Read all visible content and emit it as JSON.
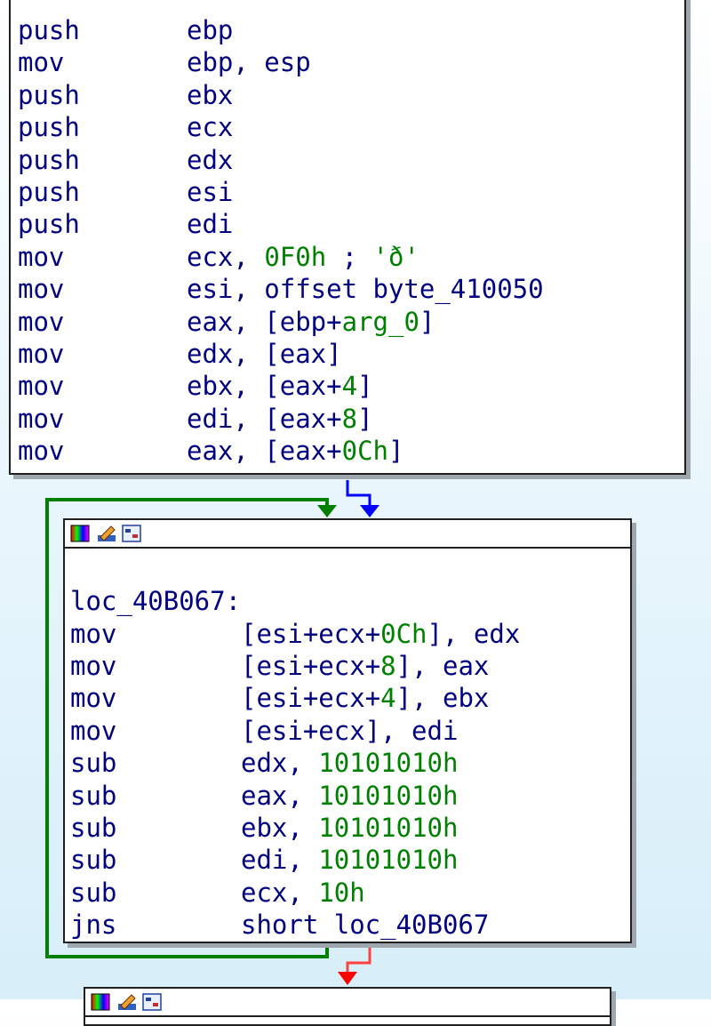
{
  "block1": {
    "lines": [
      {
        "mn": "push",
        "ops": [
          {
            "t": "ebp",
            "c": "reg"
          }
        ]
      },
      {
        "mn": "mov",
        "ops": [
          {
            "t": "ebp, esp",
            "c": "reg"
          }
        ]
      },
      {
        "mn": "push",
        "ops": [
          {
            "t": "ebx",
            "c": "reg"
          }
        ]
      },
      {
        "mn": "push",
        "ops": [
          {
            "t": "ecx",
            "c": "reg"
          }
        ]
      },
      {
        "mn": "push",
        "ops": [
          {
            "t": "edx",
            "c": "reg"
          }
        ]
      },
      {
        "mn": "push",
        "ops": [
          {
            "t": "esi",
            "c": "reg"
          }
        ]
      },
      {
        "mn": "push",
        "ops": [
          {
            "t": "edi",
            "c": "reg"
          }
        ]
      },
      {
        "mn": "mov",
        "ops": [
          {
            "t": "ecx, ",
            "c": "reg"
          },
          {
            "t": "0F0h",
            "c": "num"
          },
          {
            "t": " ; ",
            "c": "cmt"
          },
          {
            "t": "'ð'",
            "c": "str"
          }
        ]
      },
      {
        "mn": "mov",
        "ops": [
          {
            "t": "esi, offset byte_410050",
            "c": "reg"
          }
        ]
      },
      {
        "mn": "mov",
        "ops": [
          {
            "t": "eax, [ebp+",
            "c": "reg"
          },
          {
            "t": "arg_0",
            "c": "arg"
          },
          {
            "t": "]",
            "c": "reg"
          }
        ]
      },
      {
        "mn": "mov",
        "ops": [
          {
            "t": "edx, [eax]",
            "c": "reg"
          }
        ]
      },
      {
        "mn": "mov",
        "ops": [
          {
            "t": "ebx, [eax+",
            "c": "reg"
          },
          {
            "t": "4",
            "c": "num"
          },
          {
            "t": "]",
            "c": "reg"
          }
        ]
      },
      {
        "mn": "mov",
        "ops": [
          {
            "t": "edi, [eax+",
            "c": "reg"
          },
          {
            "t": "8",
            "c": "num"
          },
          {
            "t": "]",
            "c": "reg"
          }
        ]
      },
      {
        "mn": "mov",
        "ops": [
          {
            "t": "eax, [eax+",
            "c": "reg"
          },
          {
            "t": "0Ch",
            "c": "num"
          },
          {
            "t": "]",
            "c": "reg"
          }
        ]
      }
    ]
  },
  "block2": {
    "label": "loc_40B067:",
    "lines": [
      {
        "mn": "mov",
        "ops": [
          {
            "t": "[esi+ecx+",
            "c": "reg"
          },
          {
            "t": "0Ch",
            "c": "num"
          },
          {
            "t": "], edx",
            "c": "reg"
          }
        ]
      },
      {
        "mn": "mov",
        "ops": [
          {
            "t": "[esi+ecx+",
            "c": "reg"
          },
          {
            "t": "8",
            "c": "num"
          },
          {
            "t": "], eax",
            "c": "reg"
          }
        ]
      },
      {
        "mn": "mov",
        "ops": [
          {
            "t": "[esi+ecx+",
            "c": "reg"
          },
          {
            "t": "4",
            "c": "num"
          },
          {
            "t": "], ebx",
            "c": "reg"
          }
        ]
      },
      {
        "mn": "mov",
        "ops": [
          {
            "t": "[esi+ecx], edi",
            "c": "reg"
          }
        ]
      },
      {
        "mn": "sub",
        "ops": [
          {
            "t": "edx, ",
            "c": "reg"
          },
          {
            "t": "10101010h",
            "c": "num"
          }
        ]
      },
      {
        "mn": "sub",
        "ops": [
          {
            "t": "eax, ",
            "c": "reg"
          },
          {
            "t": "10101010h",
            "c": "num"
          }
        ]
      },
      {
        "mn": "sub",
        "ops": [
          {
            "t": "ebx, ",
            "c": "reg"
          },
          {
            "t": "10101010h",
            "c": "num"
          }
        ]
      },
      {
        "mn": "sub",
        "ops": [
          {
            "t": "edi, ",
            "c": "reg"
          },
          {
            "t": "10101010h",
            "c": "num"
          }
        ]
      },
      {
        "mn": "sub",
        "ops": [
          {
            "t": "ecx, ",
            "c": "reg"
          },
          {
            "t": "10h",
            "c": "num"
          }
        ]
      },
      {
        "mn": "jns",
        "ops": [
          {
            "t": "short loc_40B067",
            "c": "reg"
          }
        ]
      }
    ]
  },
  "block_header_icons": [
    "color-palette-icon",
    "edit-pencil-icon",
    "graph-view-icon"
  ],
  "edge_colors": {
    "true_branch": "#008000",
    "false_branch": "#ff0000",
    "unconditional": "#0000ff"
  }
}
